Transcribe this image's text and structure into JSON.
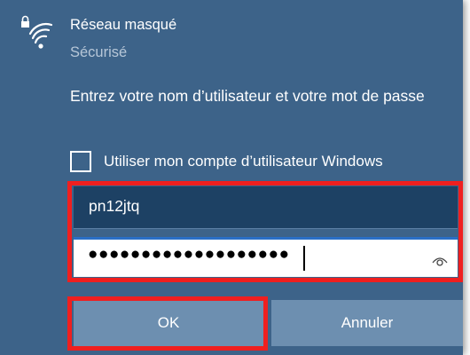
{
  "network": {
    "icon": "wifi-secured-icon",
    "name": "Réseau masqué",
    "status": "Sécurisé"
  },
  "credentials": {
    "prompt": "Entrez votre nom d’utilisateur et votre mot de passe",
    "use_windows_account_label": "Utiliser mon compte d’utilisateur Windows",
    "use_windows_account_checked": false,
    "username_value": "pn12jtq",
    "password_masked_value": "●●●●●●●●●●●●●●●●●●●",
    "reveal_password_icon": "eye-icon"
  },
  "actions": {
    "ok_label": "OK",
    "cancel_label": "Annuler"
  },
  "colors": {
    "panel_background": "#3d6389",
    "username_field_background": "#1d4164",
    "button_background": "#6d8fb0",
    "focus_border": "#2a6fc6",
    "highlight_annotation": "#ef1f1f",
    "status_text": "#b7c7d8"
  }
}
